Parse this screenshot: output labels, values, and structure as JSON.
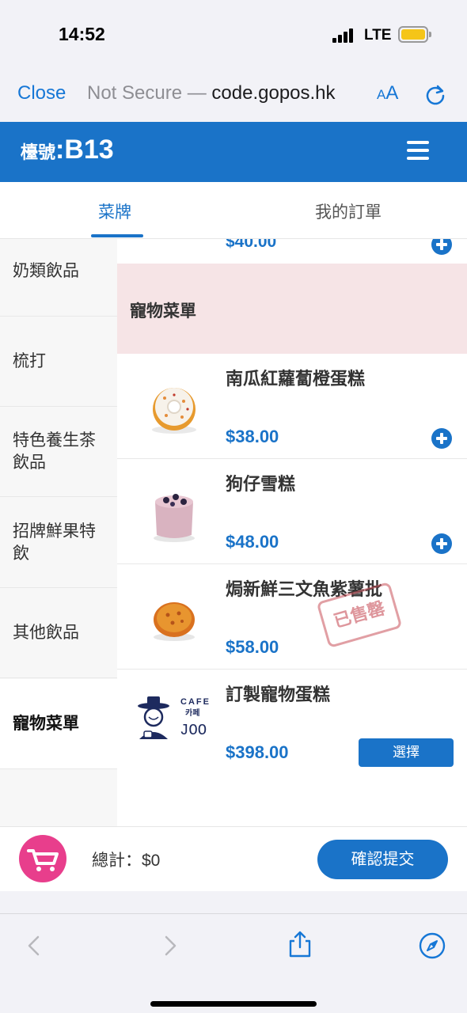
{
  "status_bar": {
    "time": "14:52",
    "network": "LTE"
  },
  "browser": {
    "close_label": "Close",
    "address_prefix": "Not Secure — ",
    "address_host": "code.gopos.hk",
    "text_size_label_small": "A",
    "text_size_label_large": "A"
  },
  "header": {
    "table_label": "檯號",
    "table_sep": ":",
    "table_number": "B13"
  },
  "tabs": [
    {
      "label": "菜牌",
      "active": true
    },
    {
      "label": "我的訂單",
      "active": false
    }
  ],
  "sidebar": {
    "items": [
      {
        "label": "奶類飲品"
      },
      {
        "label": "梳打"
      },
      {
        "label": "特色養生茶飲品"
      },
      {
        "label": "招牌鮮果特飲"
      },
      {
        "label": "其他飲品"
      },
      {
        "label": "寵物菜單",
        "active": true
      }
    ]
  },
  "menu": {
    "partial_price": "$40.00",
    "section_title": "寵物菜單",
    "items": [
      {
        "name": "南瓜紅蘿蔔橙蛋糕",
        "price": "$38.00",
        "action": "add",
        "icon": "donut-cake-image"
      },
      {
        "name": "狗仔雪糕",
        "price": "$48.00",
        "action": "add",
        "icon": "pet-ice-cream-image"
      },
      {
        "name": "焗新鮮三文魚紫薯批",
        "price": "$58.00",
        "action": "sold-out",
        "stamp": "已售罄",
        "icon": "salmon-pie-image"
      },
      {
        "name": "訂製寵物蛋糕",
        "price": "$398.00",
        "action": "select",
        "select_label": "選擇",
        "icon": "cafe-joo-logo",
        "logo_text_1": "CAFE",
        "logo_text_2": "카페",
        "logo_text_3": "JOO"
      }
    ]
  },
  "cart": {
    "total_label": "總計：",
    "total_value": "$0",
    "confirm_label": "確認提交"
  },
  "colors": {
    "primary": "#1a73c8",
    "cart_pink": "#e83e8c",
    "section_bg": "#f6e4e6",
    "stamp_red": "#c8505a"
  }
}
